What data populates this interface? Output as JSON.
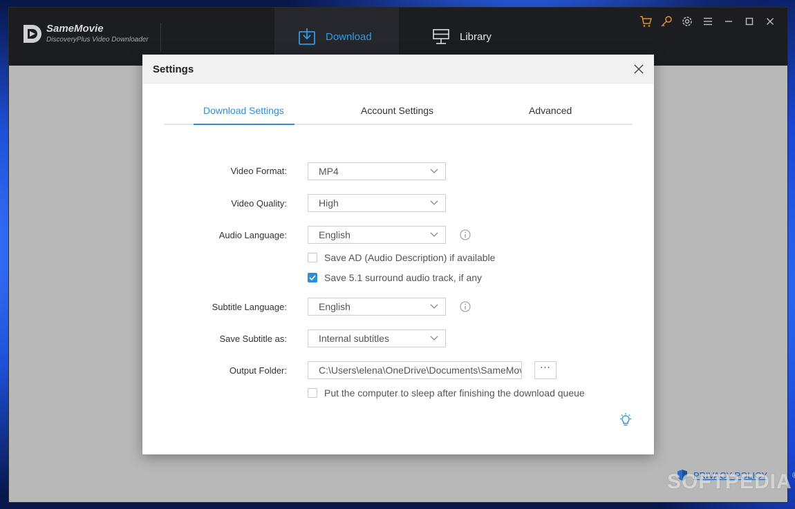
{
  "app": {
    "brand_name": "SameMovie",
    "brand_sub": "DiscoveryPlus Video Downloader",
    "nav": {
      "download": "Download",
      "library": "Library"
    },
    "privacy_link": "PRIVACY POLICY",
    "watermark": "SOFTPEDIA",
    "watermark_mark": "®",
    "accent_color": "#2e8fd8",
    "icon_accent_color": "#e0922a"
  },
  "dialog": {
    "title": "Settings",
    "tabs": {
      "download": "Download Settings",
      "account": "Account Settings",
      "advanced": "Advanced"
    },
    "video_format": {
      "label": "Video Format:",
      "value": "MP4"
    },
    "video_quality": {
      "label": "Video Quality:",
      "value": "High"
    },
    "audio_language": {
      "label": "Audio Language:",
      "value": "English"
    },
    "save_ad": {
      "label": "Save AD (Audio Description) if available",
      "checked": false
    },
    "save_51": {
      "label": "Save 5.1 surround audio track, if any",
      "checked": true
    },
    "subtitle_language": {
      "label": "Subtitle Language:",
      "value": "English"
    },
    "save_subtitle": {
      "label": "Save Subtitle as:",
      "value": "Internal subtitles"
    },
    "output_folder": {
      "label": "Output Folder:",
      "value": "C:\\Users\\elena\\OneDrive\\Documents\\SameMovie",
      "browse_label": "···"
    },
    "sleep_after": {
      "label": "Put the computer to sleep after finishing the download queue",
      "checked": false
    }
  }
}
